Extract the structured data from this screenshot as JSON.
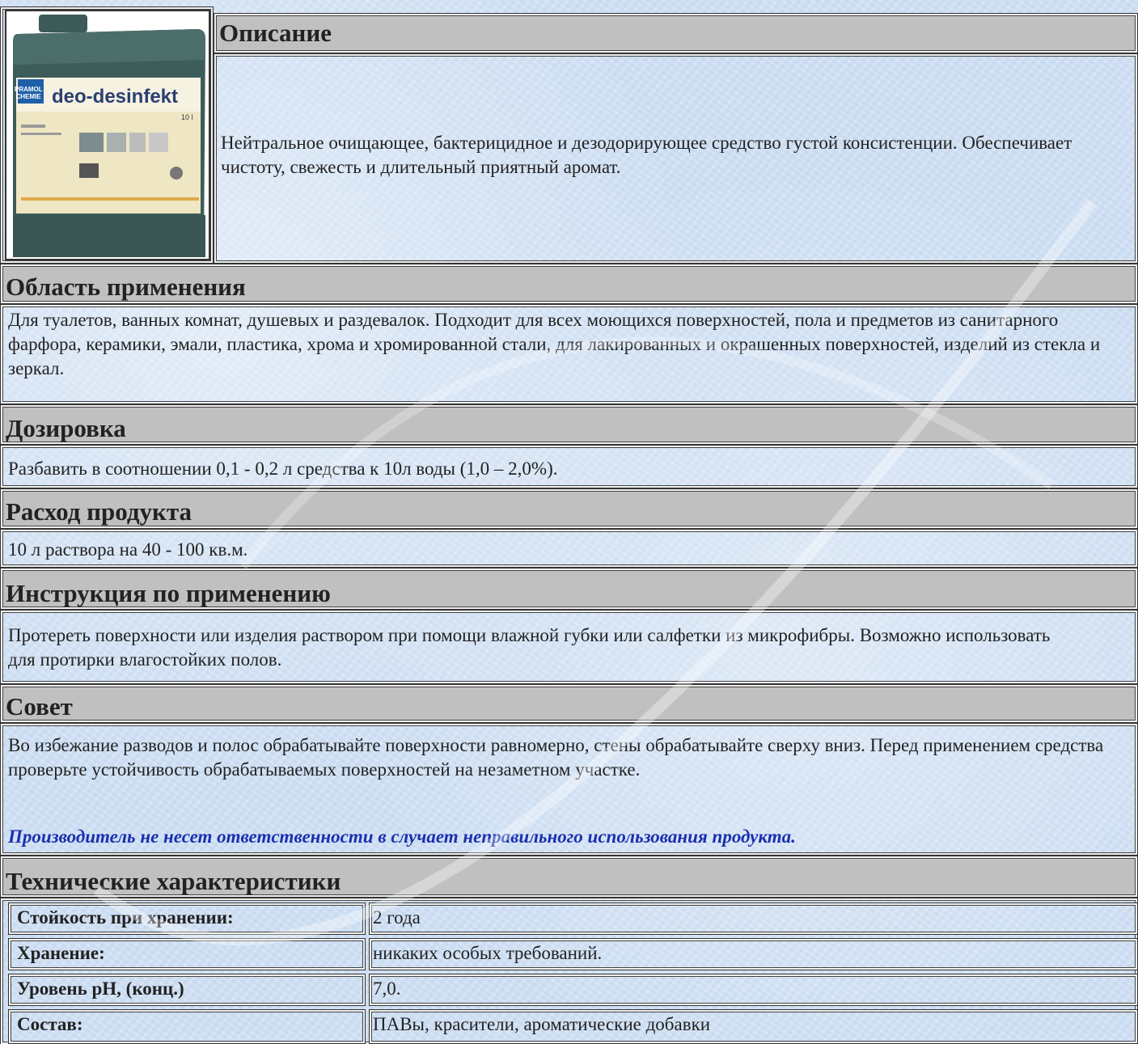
{
  "product": {
    "brand": "PRAMOL CHEMIE",
    "name": "deo-desinfekt",
    "volume": "10 l"
  },
  "sections": {
    "description": {
      "title": "Описание",
      "text": "Нейтральное очищающее, бактерицидное и дезодорирующее средство густой консистенции. Обеспечивает  чистоту, свежесть и длительный приятный аромат."
    },
    "application": {
      "title": "Область применения",
      "text": "Для туалетов, ванных комнат, душевых и раздевалок. Подходит для всех моющихся поверхностей, пола и предметов из санитарного фарфора, керамики, эмали, пластика, хрома и хромированной стали, для лакированных и окрашенных поверхностей, изделий из стекла и зеркал."
    },
    "dosage": {
      "title": "Дозировка",
      "text": "Разбавить в соотношении 0,1 - 0,2 л средства к 10л воды (1,0 – 2,0%)."
    },
    "consumption": {
      "title": "Расход продукта",
      "text": "10 л раствора на 40 - 100 кв.м."
    },
    "instructions": {
      "title": "Инструкция по применению",
      "text": "Протереть поверхности или изделия раствором при помощи влажной губки или салфетки из микрофибры. Возможно использовать для протирки влагостойких полов."
    },
    "advice": {
      "title": "Совет",
      "text": "Во избежание разводов и полос обрабатывайте поверхности равномерно, стены обрабатывайте сверху вниз. Перед применением средства проверьте устойчивость обрабатываемых поверхностей на незаметном участке.",
      "warning": "Производитель не несет ответственности в случает неправильного использования продукта."
    },
    "specs": {
      "title": "Технические характеристики",
      "rows": [
        {
          "label": "Стойкость при хранении:",
          "value": "2 года"
        },
        {
          "label": "Хранение:",
          "value": "никаких особых требований."
        },
        {
          "label": "Уровень pH, (конц.)",
          "value": "7,0."
        },
        {
          "label": "Состав:",
          "value": "ПАВы, красители, ароматические добавки"
        }
      ]
    }
  },
  "colors": {
    "header_bg": "#c0c0c0",
    "warning_text": "#1a2fb0",
    "page_bg": "#cfe0f3"
  }
}
